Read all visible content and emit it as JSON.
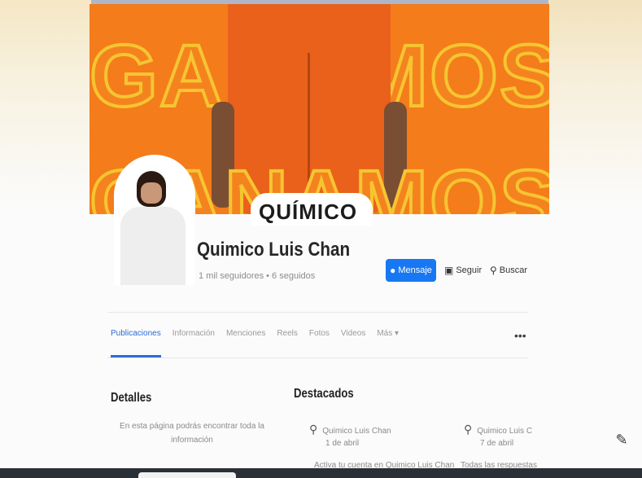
{
  "cover": {
    "word_top": "GANAMOS",
    "word_bottom": "GANAMOS",
    "badge_text": "QUÍMICO"
  },
  "profile": {
    "name": "Quimico Luis Chan",
    "subtitle": "1 mil seguidores • 6 seguidos"
  },
  "actions": {
    "message_label": "Mensaje",
    "follow_label": "Seguir",
    "search_label": "Buscar"
  },
  "tabs": [
    {
      "label": "Publicaciones"
    },
    {
      "label": "Información"
    },
    {
      "label": "Menciones"
    },
    {
      "label": "Reels"
    },
    {
      "label": "Fotos"
    },
    {
      "label": "Videos"
    },
    {
      "label": "Más ▾"
    }
  ],
  "more_menu": "•••",
  "details": {
    "title": "Detalles",
    "text": "En esta página podrás encontrar toda la información"
  },
  "featured": {
    "title": "Destacados",
    "items": [
      {
        "name": "Quimico Luis Chan",
        "meta": "1 de abril"
      },
      {
        "name": "Quimico Luis C",
        "meta": "7 de abril"
      }
    ],
    "caption_1": "Activa tu cuenta en Quimico Luis Chan",
    "caption_2": "Todas las respuestas"
  },
  "icons": {
    "message": "messenger-icon",
    "follow": "follow-icon",
    "search": "search-icon",
    "edit": "edit-icon",
    "pin": "pin-icon"
  },
  "colors": {
    "cover_orange": "#f47c1b",
    "primary_blue": "#1877f2",
    "active_tab": "#2b6dd7"
  }
}
